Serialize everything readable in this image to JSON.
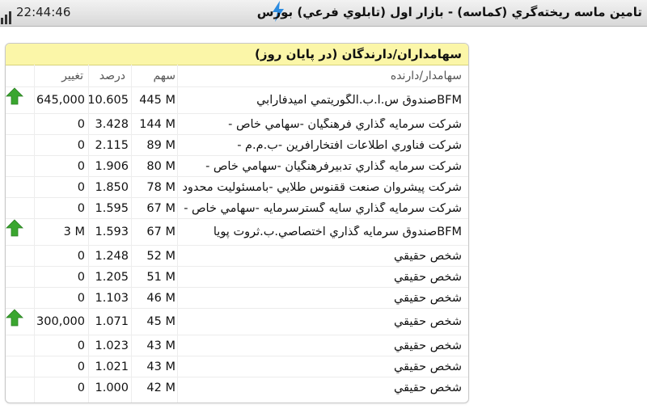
{
  "status_bar": {
    "time": "22:44:46",
    "title": "تامين ماسه ريخته‌گري (كماسه) - بازار اول (تابلوي فرعي) بورس"
  },
  "panel": {
    "title": "سهامداران/دارندگان (در پايان روز)",
    "columns": {
      "name": "سهامدار/دارنده",
      "shares": "سهم",
      "percent": "درصد",
      "change": "تغيير"
    },
    "rows": [
      {
        "name": "BFMصندوق س.ا.ب.الگوريتمي اميدفارابي",
        "shares": "445 M",
        "percent": "10.605",
        "change": "645,000",
        "arrow": "up"
      },
      {
        "name": "شركت سرمايه گذاري فرهنگيان -سهامي خاص -",
        "shares": "144 M",
        "percent": "3.428",
        "change": "0",
        "arrow": ""
      },
      {
        "name": "شركت فناوري اطلاعات افتخارآفرين -ب.م.م -",
        "shares": "89 M",
        "percent": "2.115",
        "change": "0",
        "arrow": ""
      },
      {
        "name": "شركت سرمايه گذاري تدبيرفرهنگيان -سهامي خاص -",
        "shares": "80 M",
        "percent": "1.906",
        "change": "0",
        "arrow": ""
      },
      {
        "name": "شركت پيشروان صنعت ققنوس طلايي -بامسئوليت محدود",
        "shares": "78 M",
        "percent": "1.850",
        "change": "0",
        "arrow": ""
      },
      {
        "name": "شركت سرمايه گذاري سايه گسترسرمايه -سهامي خاص -",
        "shares": "67 M",
        "percent": "1.595",
        "change": "0",
        "arrow": ""
      },
      {
        "name": "BFMصندوق سرمايه گذاري اختصاصي.ب.ثروت پويا",
        "shares": "67 M",
        "percent": "1.593",
        "change": "3 M",
        "arrow": "up"
      },
      {
        "name": "شخص حقيقي",
        "shares": "52 M",
        "percent": "1.248",
        "change": "0",
        "arrow": ""
      },
      {
        "name": "شخص حقيقي",
        "shares": "51 M",
        "percent": "1.205",
        "change": "0",
        "arrow": ""
      },
      {
        "name": "شخص حقيقي",
        "shares": "46 M",
        "percent": "1.103",
        "change": "0",
        "arrow": ""
      },
      {
        "name": "شخص حقيقي",
        "shares": "45 M",
        "percent": "1.071",
        "change": "300,000",
        "arrow": "up"
      },
      {
        "name": "شخص حقيقي",
        "shares": "43 M",
        "percent": "1.023",
        "change": "0",
        "arrow": ""
      },
      {
        "name": "شخص حقيقي",
        "shares": "43 M",
        "percent": "1.021",
        "change": "0",
        "arrow": ""
      },
      {
        "name": "شخص حقيقي",
        "shares": "42 M",
        "percent": "1.000",
        "change": "0",
        "arrow": ""
      }
    ]
  },
  "colors": {
    "header_bg": "#fbf6a8",
    "arrow_up": "#3aa62f",
    "bolt": "#2b8be0"
  },
  "icons": {
    "status_left": "bar-chart-icon",
    "status_center": "lightning-bolt-icon",
    "row_change": "up-arrow-icon"
  }
}
